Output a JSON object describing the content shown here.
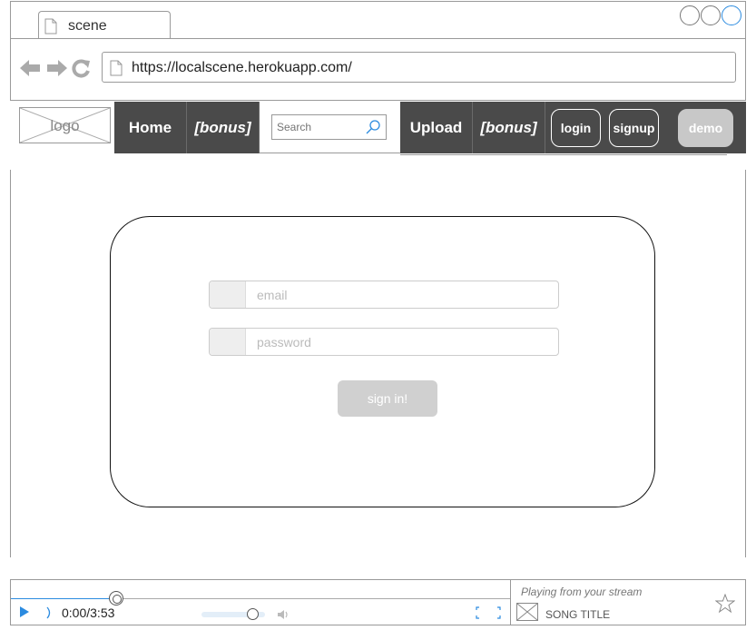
{
  "browser": {
    "tab_title": "scene",
    "url": "https://localscene.herokuapp.com/"
  },
  "navbar": {
    "logo_label": "logo",
    "home_label": "Home",
    "bonus_left_label": "[bonus]",
    "search_placeholder": "Search",
    "upload_label": "Upload",
    "bonus_right_label": "[bonus]",
    "login_label": "login",
    "signup_label": "signup",
    "demo_label": "demo"
  },
  "login_form": {
    "email_placeholder": "email",
    "password_placeholder": "password",
    "signin_label": "sign in!"
  },
  "player": {
    "time_display": "0:00/3:53",
    "progress_fraction": 0.21,
    "volume_fraction": 0.8,
    "stream_label": "Playing from your stream",
    "song_title": "SONG TITLE"
  },
  "colors": {
    "nav_dark": "#4a4a4a",
    "accent_blue": "#2b8be0",
    "button_disabled": "#d0d0d0"
  },
  "icons": {
    "back": "back-arrow-icon",
    "forward": "forward-arrow-icon",
    "reload": "reload-icon",
    "page": "page-icon",
    "search": "search-icon",
    "play": "play-icon",
    "volume": "volume-icon",
    "fullscreen": "fullscreen-icon",
    "star": "star-icon"
  }
}
